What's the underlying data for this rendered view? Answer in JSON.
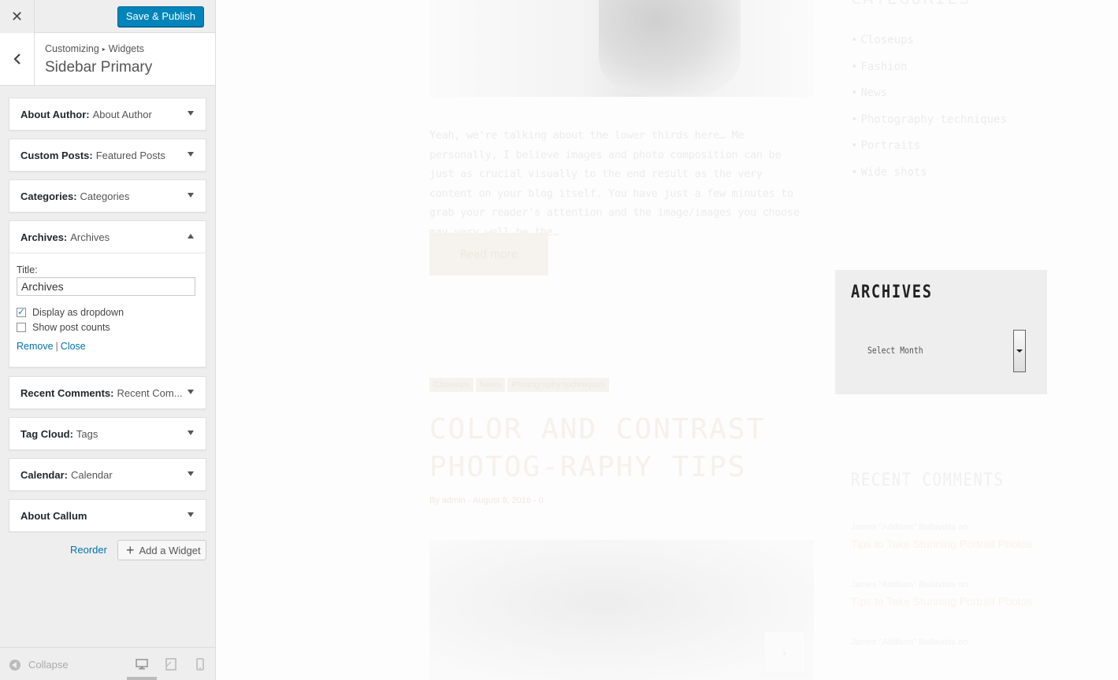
{
  "customizer": {
    "close_icon": "close-icon",
    "publish_label": "Save & Publish",
    "breadcrumb": {
      "part1": "Customizing",
      "separator": "▸",
      "part2": "Widgets"
    },
    "section_title": "Sidebar Primary",
    "widgets": [
      {
        "name": "About Author:",
        "instance": "About Author",
        "expanded": false
      },
      {
        "name": "Custom Posts:",
        "instance": "Featured Posts",
        "expanded": false
      },
      {
        "name": "Categories:",
        "instance": "Categories",
        "expanded": false
      },
      {
        "name": "Archives:",
        "instance": "Archives",
        "expanded": true
      },
      {
        "name": "Recent Comments:",
        "instance": "Recent Com...",
        "expanded": false
      },
      {
        "name": "Tag Cloud:",
        "instance": "Tags",
        "expanded": false
      },
      {
        "name": "Calendar:",
        "instance": "Calendar",
        "expanded": false
      },
      {
        "name": "About Callum",
        "instance": "",
        "expanded": false
      }
    ],
    "archives_form": {
      "title_label": "Title:",
      "title_value": "Archives",
      "dropdown_label": "Display as dropdown",
      "dropdown_checked": true,
      "counts_label": "Show post counts",
      "counts_checked": false,
      "remove_label": "Remove",
      "pipe": "|",
      "close_label": "Close"
    },
    "reorder_label": "Reorder",
    "add_widget_label": "Add a Widget",
    "collapse_label": "Collapse",
    "accent_color": "#0085ba",
    "link_color": "#0073aa"
  },
  "preview": {
    "excerpt": "Yeah, we're talking about the lower thirds here… Me personally, I believe images and photo composition can be just as crucial visually to the end result as the very content on your blog itself. You have just a few minutes to grab your reader's attention and the image/images you choose may very well be the…",
    "read_more": "Read more",
    "tags": [
      "Closeups",
      "News",
      "Photography techniques"
    ],
    "post_title": "COLOR AND CONTRAST PHOTOG-RAPHY TIPS",
    "post_meta": "By admin - August 8, 2016 - 0",
    "categories_heading": "CATEGORIES",
    "categories": [
      "Closeups",
      "Fashion",
      "News",
      "Photography techniques",
      "Portraits",
      "Wide shots"
    ],
    "archives_heading": "ARCHIVES",
    "archives_select": "Select Month",
    "recent_comments_heading": "RECENT COMMENTS",
    "recent_comments": [
      {
        "author": "James \"Addison\" Bellavista on",
        "title": "Tips to Take Stunning Portrait Photos"
      },
      {
        "author": "James \"Addison\" Bellavista on",
        "title": "Tips to Take Stunning Portrait Photos"
      },
      {
        "author": "James \"Addison\" Bellavista on",
        "title": ""
      }
    ]
  }
}
